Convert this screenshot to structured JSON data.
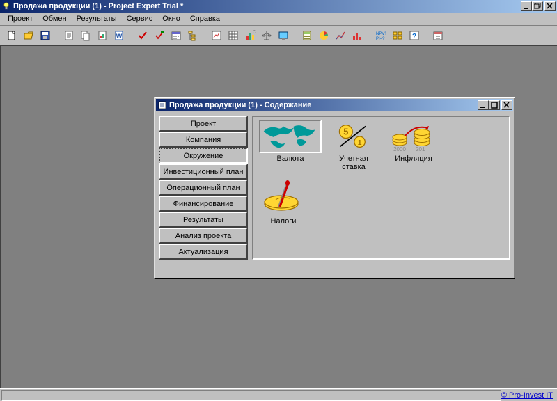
{
  "app_title": "Продажа продукции (1) - Project Expert Trial *",
  "menus": [
    "Проект",
    "Обмен",
    "Результаты",
    "Сервис",
    "Окно",
    "Справка"
  ],
  "toolbar": [
    "new",
    "open",
    "save",
    "sep",
    "text-report",
    "copy",
    "chart-report",
    "word-report",
    "sep",
    "check-red",
    "check-green",
    "calendar",
    "tree",
    "sep",
    "small-chart",
    "grid",
    "bar-chart",
    "balance",
    "screen",
    "sep",
    "calc",
    "pie",
    "trend",
    "red-bars",
    "sep",
    "npv",
    "breakdown",
    "question",
    "sep",
    "calendar2"
  ],
  "child": {
    "title": "Продажа продукции (1) - Содержание",
    "nav_items": [
      "Проект",
      "Компания",
      "Окружение",
      "Инвестиционный план",
      "Операционный план",
      "Финансирование",
      "Результаты",
      "Анализ проекта",
      "Актуализация"
    ],
    "active_nav": "Окружение",
    "content_top": [
      {
        "key": "currency",
        "label": "Валюта"
      },
      {
        "key": "rate",
        "label": "Учетная ставка"
      },
      {
        "key": "inflation",
        "label": "Инфляция"
      }
    ],
    "content_bottom": [
      {
        "key": "tax",
        "label": "Налоги"
      }
    ]
  },
  "status_credit": "© Pro-Invest IT"
}
